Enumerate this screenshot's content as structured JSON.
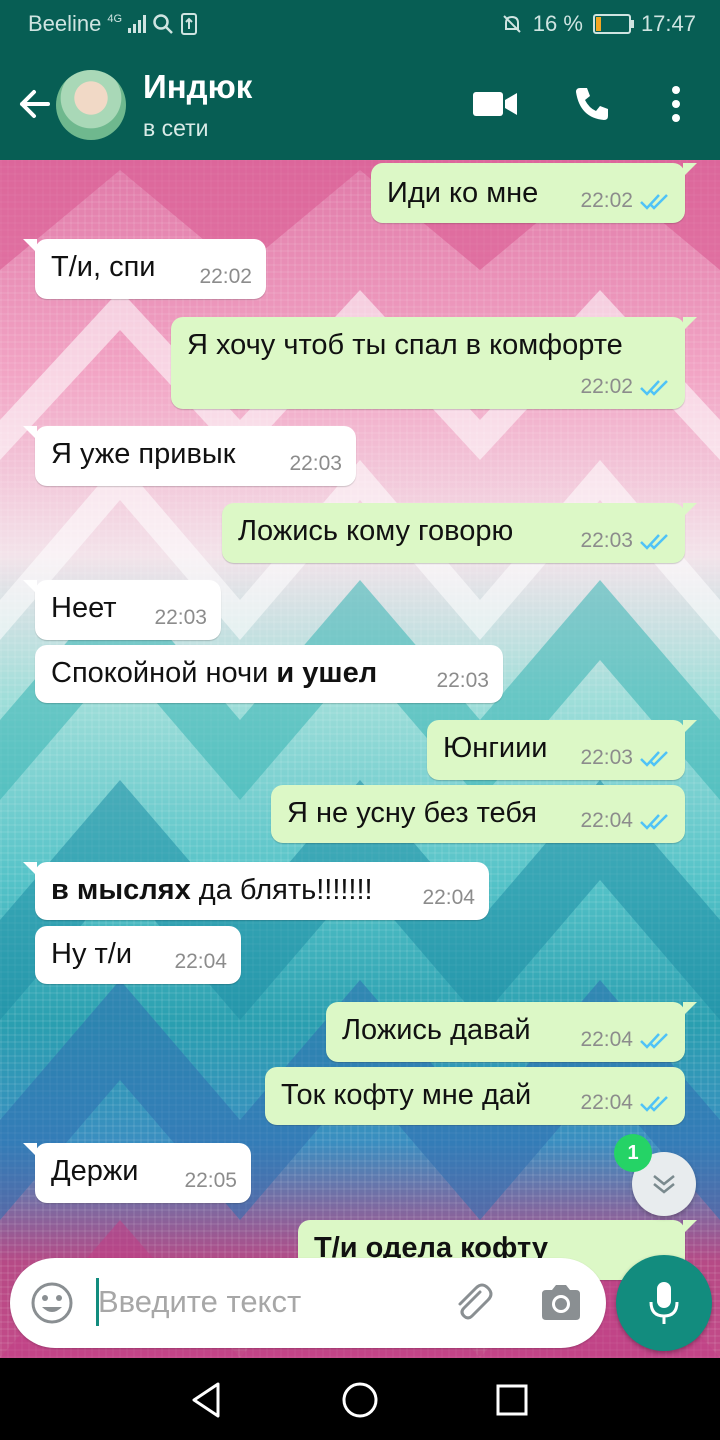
{
  "status_bar": {
    "carrier": "Beeline",
    "network": "4G",
    "battery": "16 %",
    "battery_level": 0.16,
    "time": "17:47"
  },
  "header": {
    "contact_name": "Индюк",
    "contact_status": "в сети"
  },
  "messages": [
    {
      "dir": "out",
      "text": "Иди ко мне",
      "time": "22:02"
    },
    {
      "dir": "in",
      "text": "Т/и, спи",
      "time": "22:02"
    },
    {
      "dir": "out",
      "text": "Я хочу чтоб ты спал в комфорте",
      "time": "22:02"
    },
    {
      "dir": "in",
      "text": "Я уже привык",
      "time": "22:03"
    },
    {
      "dir": "out",
      "text": "Ложись кому говорю",
      "time": "22:03"
    },
    {
      "dir": "in",
      "text": "Неет",
      "time": "22:03"
    },
    {
      "dir": "in",
      "text_a": "Спокойной ночи ",
      "text_b": "и ушел",
      "time": "22:03"
    },
    {
      "dir": "out",
      "text": "Юнгиии",
      "time": "22:03"
    },
    {
      "dir": "out",
      "text": "Я не усну без тебя",
      "time": "22:04"
    },
    {
      "dir": "in",
      "text_a": "в мыслях",
      "text_b": " да блять!!!!!!!",
      "time": "22:04"
    },
    {
      "dir": "in",
      "text": "Ну т/и",
      "time": "22:04"
    },
    {
      "dir": "out",
      "text": "Ложись давай",
      "time": "22:04"
    },
    {
      "dir": "out",
      "text": "Ток кофту мне дай",
      "time": "22:04"
    },
    {
      "dir": "in",
      "text": "Держи",
      "time": "22:05"
    },
    {
      "dir": "out",
      "text": "Т/и одела кофту",
      "time": ""
    }
  ],
  "unread_badge": "1",
  "input": {
    "placeholder": "Введите текст"
  },
  "colors": {
    "header": "#075e54",
    "outgoing": "#dcf8c6",
    "incoming": "#ffffff",
    "accent": "#128c7e",
    "tick": "#4fc3f7"
  },
  "icons": [
    "back-arrow-icon",
    "video-call-icon",
    "phone-icon",
    "more-icon",
    "emoji-icon",
    "attach-icon",
    "camera-icon",
    "mic-icon",
    "scroll-down-icon",
    "nav-back-icon",
    "nav-home-icon",
    "nav-recents-icon"
  ]
}
